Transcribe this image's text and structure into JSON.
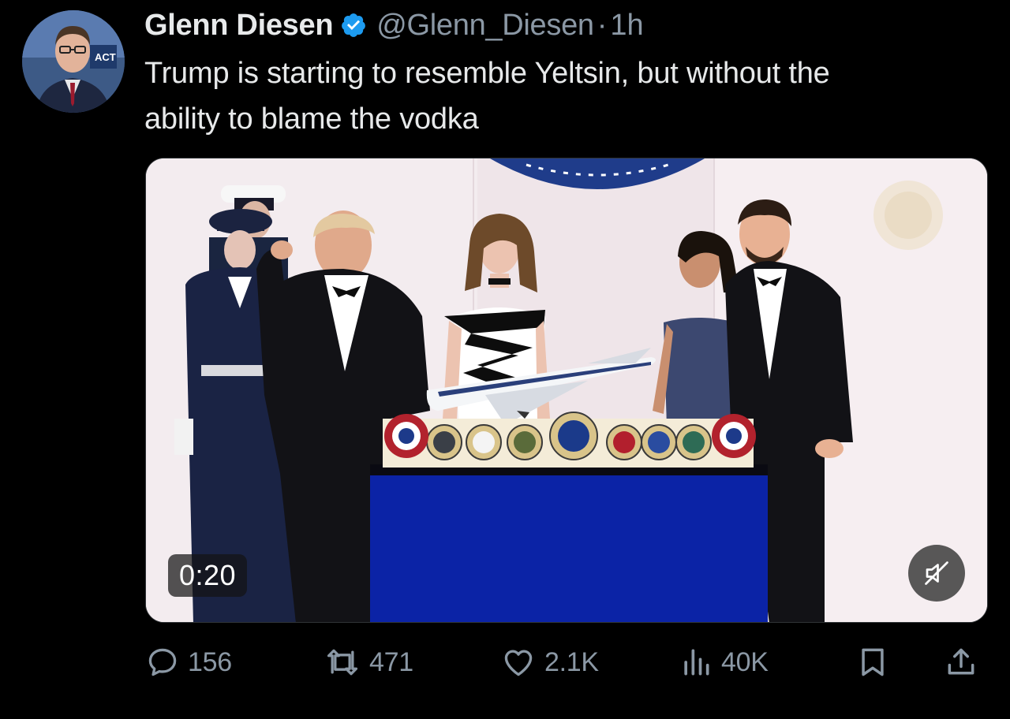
{
  "author": {
    "name": "Glenn Diesen",
    "handle": "@Glenn_Diesen",
    "separator": "·",
    "time": "1h",
    "avatar_badge_text": "ACT"
  },
  "tweet": {
    "line1": "Trump is starting to resemble Yeltsin, but without the",
    "line2": "ability to blame the vodka"
  },
  "media": {
    "type": "video",
    "duration": "0:20",
    "muted": true
  },
  "actions": {
    "replies": "156",
    "reposts": "471",
    "likes": "2.1K",
    "views": "40K"
  },
  "icons": {
    "verified": "verified-badge-icon",
    "reply": "reply-icon",
    "repost": "repost-icon",
    "like": "heart-icon",
    "views": "views-icon",
    "bookmark": "bookmark-icon",
    "share": "share-icon",
    "mute": "muted-speaker-icon"
  },
  "colors": {
    "background": "#000000",
    "text_primary": "#e7e9ea",
    "text_secondary": "#8b98a5",
    "verified_blue": "#1d9bf0"
  }
}
